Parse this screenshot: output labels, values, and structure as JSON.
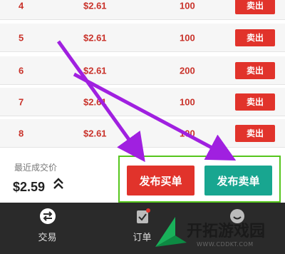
{
  "rows": [
    {
      "num": "4",
      "price": "$2.61",
      "qty": "100",
      "action": "卖出"
    },
    {
      "num": "5",
      "price": "$2.61",
      "qty": "100",
      "action": "卖出"
    },
    {
      "num": "6",
      "price": "$2.61",
      "qty": "200",
      "action": "卖出"
    },
    {
      "num": "7",
      "price": "$2.61",
      "qty": "100",
      "action": "卖出"
    },
    {
      "num": "8",
      "price": "$2.61",
      "qty": "100",
      "action": "卖出"
    }
  ],
  "action_bar": {
    "last_price_label": "最近成交价",
    "last_price_value": "$2.59",
    "publish_left_label": "发布买单",
    "publish_right_label": "发布卖单",
    "accent_red": "#e1332b",
    "accent_green": "#18a690"
  },
  "tabs": [
    {
      "label": "交易",
      "icon": "swap-icon"
    },
    {
      "label": "订单",
      "icon": "clipboard-icon"
    },
    {
      "label": "",
      "icon": "smile-icon"
    }
  ],
  "watermark": {
    "text": "开拓游戏园",
    "url": "WWW.CDDKT.COM"
  }
}
